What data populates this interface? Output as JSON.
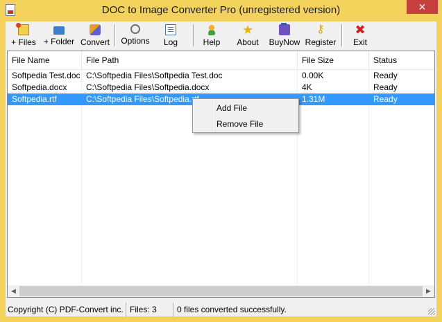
{
  "window": {
    "title": "DOC to Image Converter Pro (unregistered version)",
    "close_label": "✕"
  },
  "toolbar": [
    {
      "label": "+ Files",
      "icon": "add-files-icon"
    },
    {
      "label": "+ Folder",
      "icon": "add-folder-icon"
    },
    {
      "label": "Convert",
      "icon": "convert-icon"
    },
    {
      "label": "Options",
      "icon": "options-icon"
    },
    {
      "label": "Log",
      "icon": "log-icon"
    },
    {
      "label": "Help",
      "icon": "help-icon"
    },
    {
      "label": "About",
      "icon": "about-icon"
    },
    {
      "label": "BuyNow",
      "icon": "buynow-icon"
    },
    {
      "label": "Register",
      "icon": "register-icon"
    },
    {
      "label": "Exit",
      "icon": "exit-icon"
    }
  ],
  "table": {
    "columns": [
      "File Name",
      "File Path",
      "File Size",
      "Status"
    ],
    "rows": [
      [
        "Softpedia Test.doc",
        "C:\\Softpedia Files\\Softpedia Test.doc",
        "0.00K",
        "Ready"
      ],
      [
        "Softpedia.docx",
        "C:\\Softpedia Files\\Softpedia.docx",
        "4K",
        "Ready"
      ],
      [
        "Softpedia.rtf",
        "C:\\Softpedia Files\\Softpedia.rtf",
        "1.31M",
        "Ready"
      ]
    ],
    "selected_row": 2
  },
  "context_menu": {
    "items": [
      "Add File",
      "Remove File"
    ]
  },
  "statusbar": {
    "copyright": "Copyright (C) PDF-Convert inc.",
    "files": "Files: 3",
    "message": "0 files converted successfully."
  },
  "colors": {
    "titlebar": "#f3d25b",
    "close": "#c74040",
    "selection": "#3399ff"
  }
}
